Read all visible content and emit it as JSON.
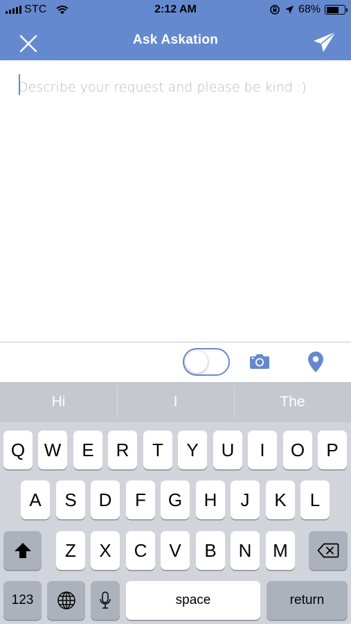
{
  "status_bar": {
    "carrier": "STC",
    "time": "2:12 AM",
    "battery_percent": "68%",
    "battery_level": 0.68
  },
  "nav": {
    "title": "Ask Askation",
    "close_icon": "close-icon",
    "send_icon": "paper-plane-icon"
  },
  "compose": {
    "placeholder": "Describe your request and please be kind :)",
    "value": ""
  },
  "accessory": {
    "toggle_on": false,
    "camera_icon": "camera-icon",
    "location_icon": "location-pin-icon"
  },
  "keyboard": {
    "suggestions": [
      "Hi",
      "I",
      "The"
    ],
    "row1": [
      "Q",
      "W",
      "E",
      "R",
      "T",
      "Y",
      "U",
      "I",
      "O",
      "P"
    ],
    "row2": [
      "A",
      "S",
      "D",
      "F",
      "G",
      "H",
      "J",
      "K",
      "L"
    ],
    "row3": [
      "Z",
      "X",
      "C",
      "V",
      "B",
      "N",
      "M"
    ],
    "numbers_label": "123",
    "space_label": "space",
    "return_label": "return"
  },
  "colors": {
    "accent": "#6589cf",
    "keyboard_bg": "#d1d4da",
    "suggestion_bar": "#c5c8cf",
    "dark_key": "#acb2bc"
  }
}
